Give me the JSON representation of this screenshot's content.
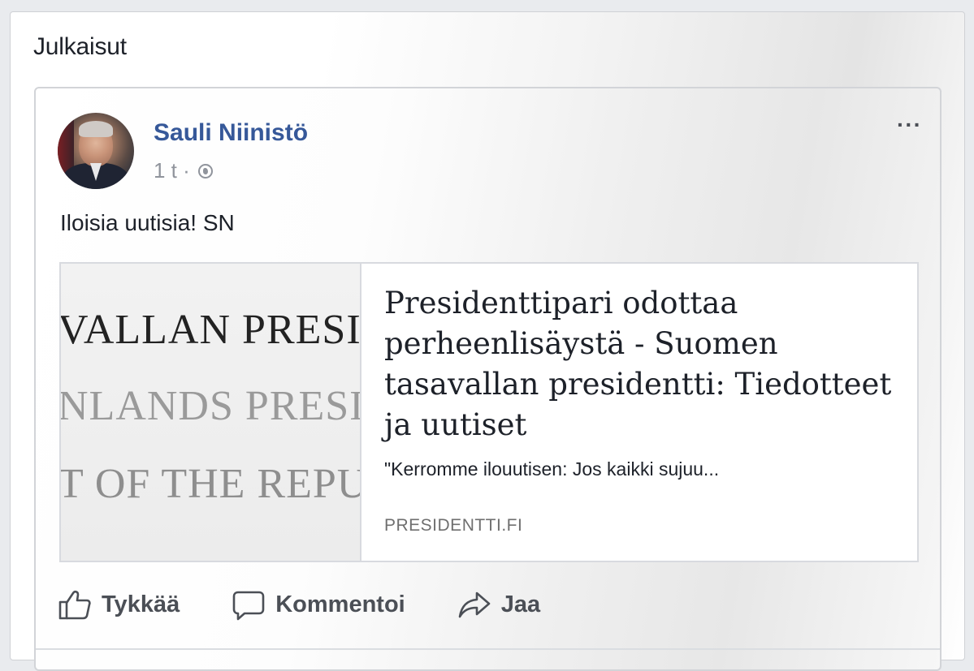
{
  "section": {
    "title": "Julkaisut"
  },
  "post": {
    "author": "Sauli Niinistö",
    "time": "1 t ·",
    "text": "Iloisia uutisia! SN",
    "more_label": "···",
    "link": {
      "image_lines": [
        "VALLAN PRESID",
        "NLANDS PRESI",
        "T OF THE REPU"
      ],
      "title": "Presidenttipari odottaa perheenlisäystä - Suomen tasavallan presidentti: Tiedotteet ja uutiset",
      "description": "\"Kerromme ilouutisen: Jos kaikki sujuu...",
      "domain": "PRESIDENTTI.FI"
    },
    "actions": {
      "like": "Tykkää",
      "comment": "Kommentoi",
      "share": "Jaa"
    }
  },
  "icons": {
    "privacy": "globe-icon",
    "like": "thumbs-up-icon",
    "comment": "speech-bubble-icon",
    "share": "share-arrow-icon",
    "more": "ellipsis-icon"
  },
  "colors": {
    "author": "#365899",
    "text": "#1d2129",
    "secondary": "#90949c"
  }
}
